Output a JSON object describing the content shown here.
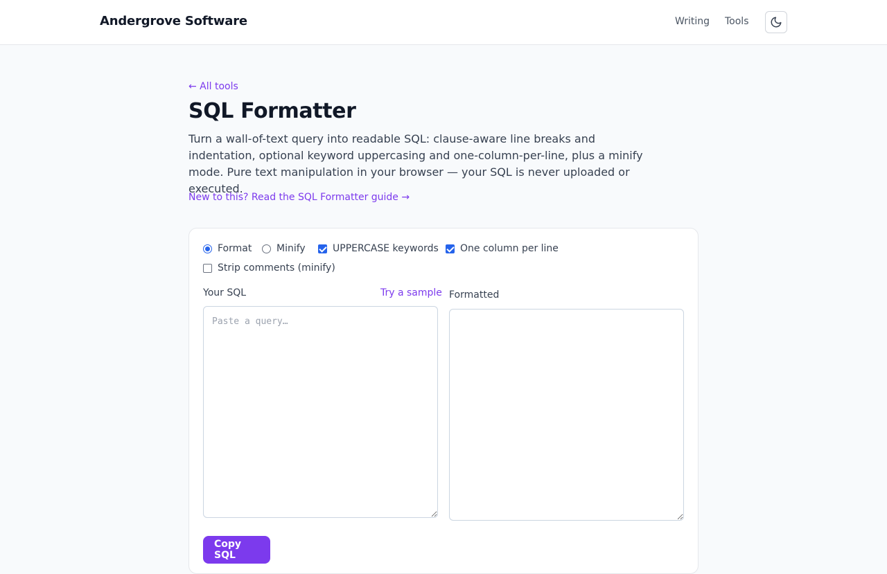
{
  "header": {
    "brand": "Andergrove Software",
    "nav": [
      {
        "label": "Writing"
      },
      {
        "label": "Tools"
      }
    ],
    "theme_icon": "moon-icon"
  },
  "main": {
    "back_label": "← All tools",
    "title": "SQL Formatter",
    "description": "Turn a wall-of-text query into readable SQL: clause-aware line breaks and indentation, optional keyword uppercasing and one-column-per-line, plus a minify mode. Pure text manipulation in your browser — your SQL is never uploaded or executed.",
    "guide_label": "New to this? Read the SQL Formatter guide →"
  },
  "options": {
    "format_label": "Format",
    "minify_label": "Minify",
    "mode": "Format",
    "uppercase_label": "UPPERCASE keywords",
    "uppercase_checked": true,
    "one_column_label": "One column per line",
    "one_column_checked": true,
    "strip_comments_label": "Strip comments (minify)",
    "strip_comments_checked": false
  },
  "input": {
    "label": "Your SQL",
    "sample_label": "Try a sample",
    "placeholder": "Paste a query…",
    "value": ""
  },
  "output": {
    "label": "Formatted",
    "value": ""
  },
  "actions": {
    "copy_label": "Copy SQL"
  },
  "colors": {
    "accent": "#7c3aed",
    "control": "#2563eb"
  }
}
